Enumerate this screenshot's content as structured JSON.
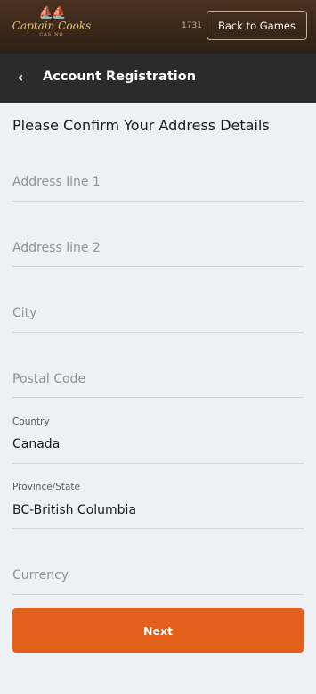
{
  "topbar": {
    "logo_text": "Captain Cooks",
    "logo_sub": "CASINO",
    "counter": "1731",
    "back_label": "Back to Games"
  },
  "header": {
    "title": "Account Registration"
  },
  "form": {
    "heading": "Please Confirm Your Address Details",
    "address1_placeholder": "Address line 1",
    "address2_placeholder": "Address line 2",
    "city_placeholder": "City",
    "postal_placeholder": "Postal Code",
    "country_label": "Country",
    "country_value": "Canada",
    "province_label": "Province/State",
    "province_value": "BC-British Columbia",
    "currency_placeholder": "Currency",
    "next_label": "Next"
  },
  "colors": {
    "accent": "#e35f1c",
    "header_bg": "#2b2b2b",
    "page_bg": "#eef1f3"
  }
}
